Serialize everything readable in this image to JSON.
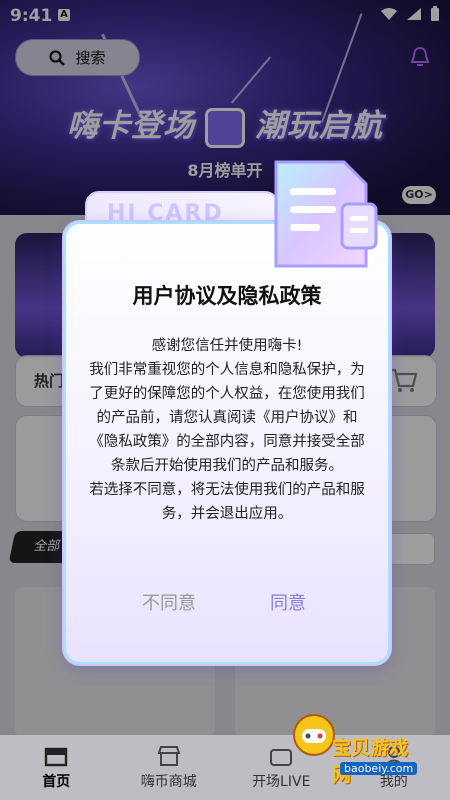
{
  "status_bar": {
    "time": "9:41",
    "notif_icon": "A"
  },
  "header": {
    "search_label": "搜索"
  },
  "banner": {
    "title_left": "嗨卡登场",
    "title_right": "潮玩启航",
    "subtitle": "8月榜单开",
    "go": "GO>"
  },
  "page": {
    "hot_label": "热门",
    "all_tab": "全部",
    "tab_right": ""
  },
  "tab_bar": {
    "items": [
      {
        "label": "首页"
      },
      {
        "label": "嗨币商城"
      },
      {
        "label": "开场LIVE"
      },
      {
        "label": "我的"
      }
    ]
  },
  "dialog": {
    "folder_tab_text": "HI CARD",
    "title": "用户协议及隐私政策",
    "body": [
      "感谢您信任并使用嗨卡!",
      "我们非常重视您的个人信息和隐私保护，为了更好的保障您的个人权益，在您使用我们的产品前，请您认真阅读《用户协议》和《隐私政策》的全部内容，同意并接受全部条款后开始使用我们的产品和服务。",
      "若选择不同意，将无法使用我们的产品和服务，并会退出应用。"
    ],
    "disagree": "不同意",
    "agree": "同意"
  },
  "watermark": {
    "text": "宝贝游戏网",
    "url": "baobeiy.com"
  },
  "colors": {
    "accent": "#8a7ce0",
    "banner": "#3a2b8c"
  }
}
